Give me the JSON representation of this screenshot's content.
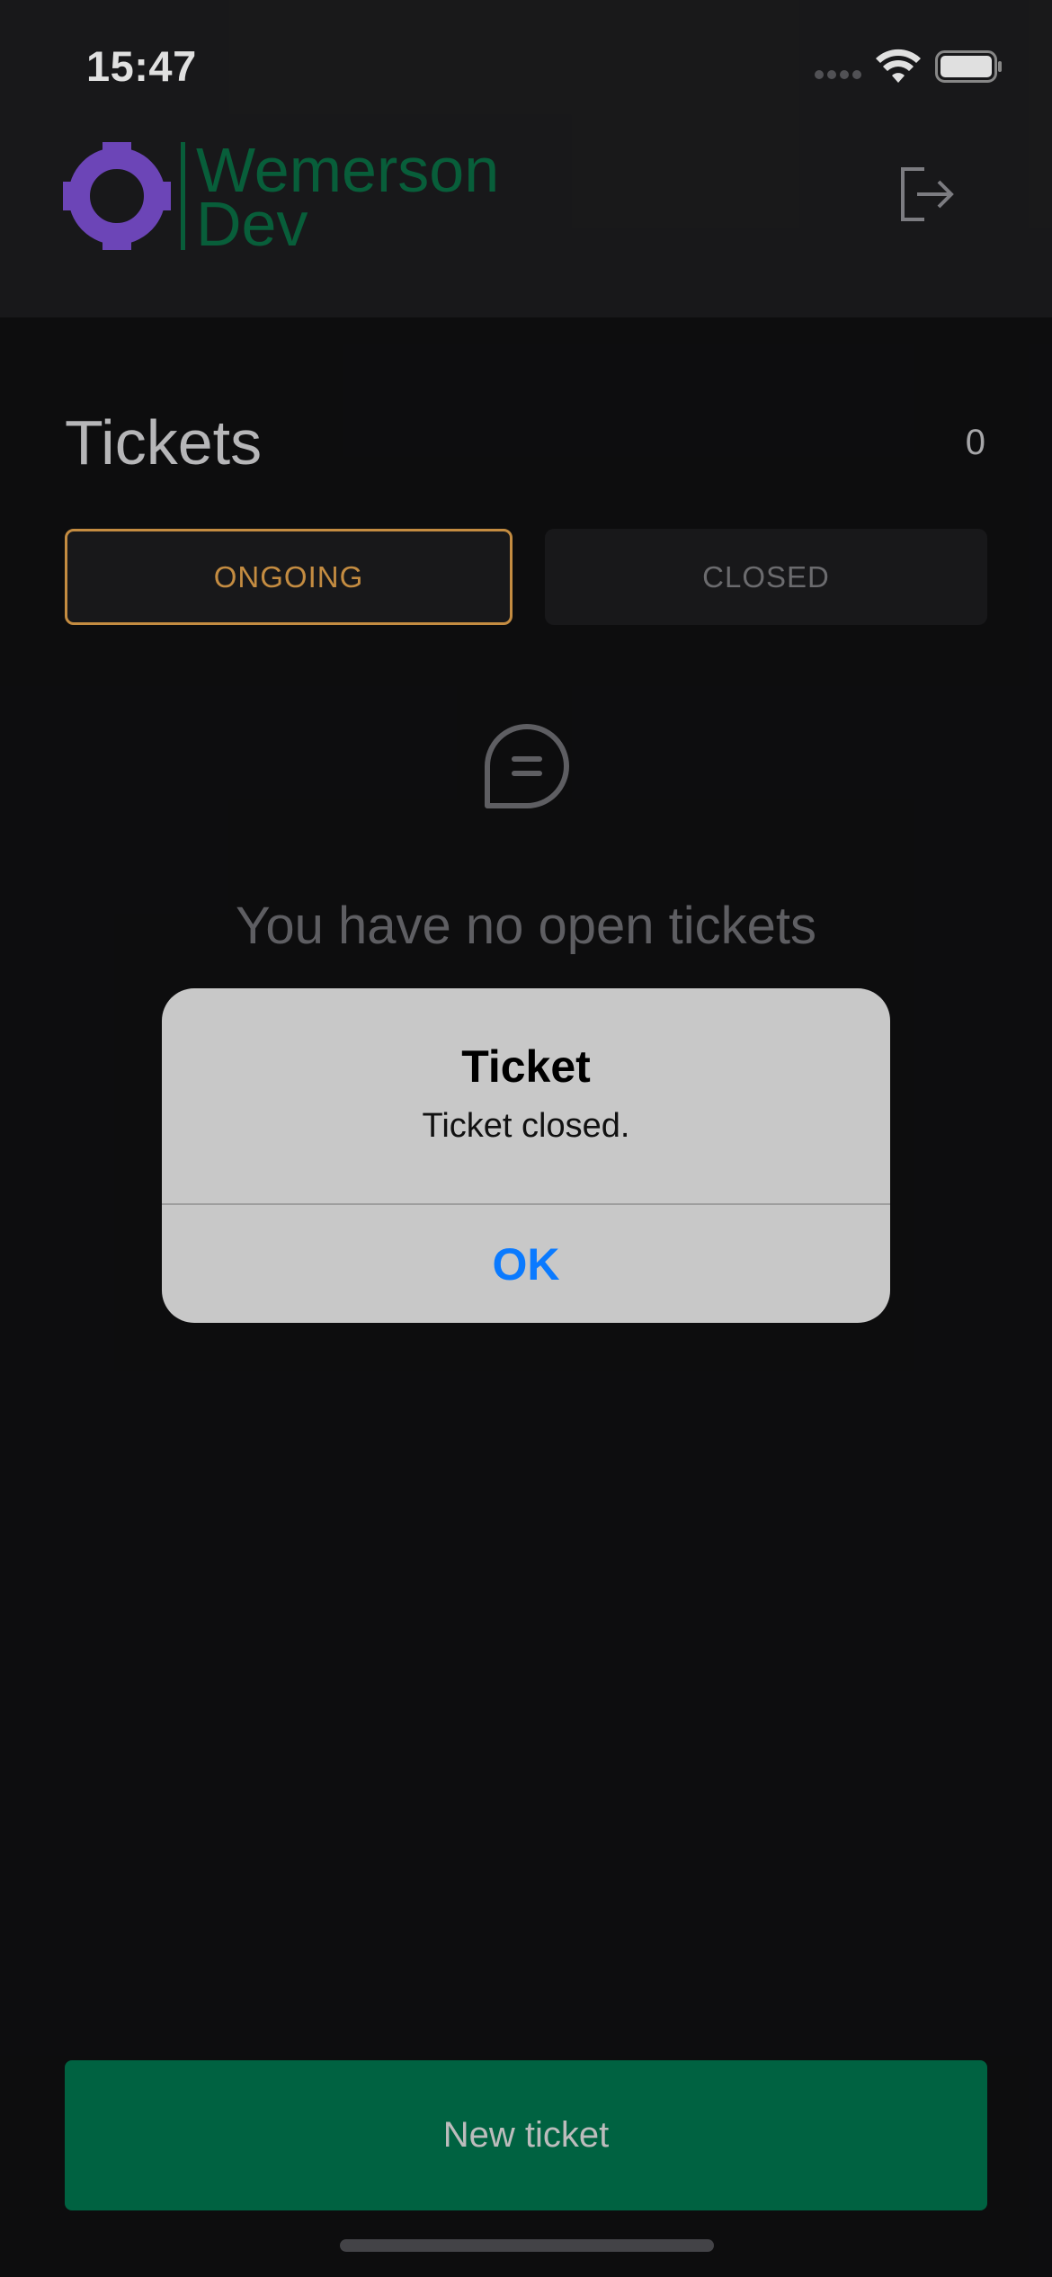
{
  "status_bar": {
    "time": "15:47",
    "icons": [
      "signal-dots-icon",
      "wifi-icon",
      "battery-icon"
    ]
  },
  "header": {
    "logo_line1": "Wemerson",
    "logo_line2": "Dev",
    "logout_icon": "logout-icon"
  },
  "page": {
    "title": "Tickets",
    "count": "0"
  },
  "tabs": [
    {
      "label": "ONGOING",
      "active": true
    },
    {
      "label": "CLOSED",
      "active": false
    }
  ],
  "empty_state": {
    "icon": "chat-bubble-icon",
    "text": "You have no open tickets"
  },
  "alert": {
    "title": "Ticket",
    "message": "Ticket closed.",
    "ok_label": "OK"
  },
  "footer": {
    "new_ticket_label": "New ticket"
  },
  "colors": {
    "accent_orange": "#e0a04b",
    "brand_green": "#00704a",
    "logo_purple": "#7b4fd1",
    "ios_blue": "#0a7aff"
  }
}
